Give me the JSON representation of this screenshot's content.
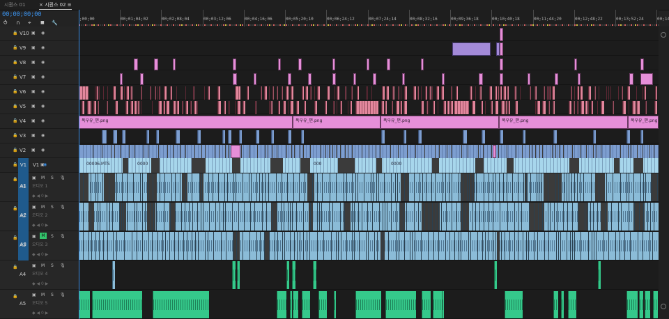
{
  "tabs": [
    {
      "label": "시퀀스 01",
      "active": false
    },
    {
      "label": "×  시퀀스 02  ≡",
      "active": true
    }
  ],
  "timecode": "00;00;00;00",
  "tools": [
    {
      "icon": "snap-icon",
      "glyph": "⥁"
    },
    {
      "icon": "linked-selection-icon",
      "glyph": "∩"
    },
    {
      "icon": "add-marker-icon",
      "glyph": "⌖"
    },
    {
      "icon": "marker-icon",
      "glyph": "■"
    },
    {
      "icon": "wrench-icon",
      "glyph": "🔧"
    }
  ],
  "ruler": [
    {
      "label": ";00;00",
      "pos": 0.0
    },
    {
      "label": "00;01;04;02",
      "pos": 0.0712
    },
    {
      "label": "00;02;08;04",
      "pos": 0.1424
    },
    {
      "label": "00;03;12;06",
      "pos": 0.2136
    },
    {
      "label": "00;04;16;06",
      "pos": 0.2848
    },
    {
      "label": "00;05;20;10",
      "pos": 0.356
    },
    {
      "label": "00;06;24;12",
      "pos": 0.4272
    },
    {
      "label": "00;07;24;14",
      "pos": 0.4984
    },
    {
      "label": "00;08;32;16",
      "pos": 0.5696
    },
    {
      "label": "00;09;36;18",
      "pos": 0.6408
    },
    {
      "label": "00;10;40;18",
      "pos": 0.712
    },
    {
      "label": "00;11;44;20",
      "pos": 0.7832
    },
    {
      "label": "00;12;48;22",
      "pos": 0.8544
    },
    {
      "label": "00;13;52;24",
      "pos": 0.9256
    },
    {
      "label": "00;14;56;26",
      "pos": 0.9968
    }
  ],
  "video_tracks": [
    "V10",
    "V9",
    "V8",
    "V7",
    "V6",
    "V5",
    "V4",
    "V3",
    "V2",
    "V1"
  ],
  "audio_tracks": [
    {
      "name": "A1",
      "label": "오디오 1"
    },
    {
      "name": "A2",
      "label": "오디오 2"
    },
    {
      "name": "A3",
      "label": "오디오 3"
    },
    {
      "name": "A4",
      "label": "오디오 4"
    },
    {
      "name": "A5",
      "label": "오디오 5"
    }
  ],
  "source_patch": {
    "video": "V1",
    "audio": [
      "A1",
      "A2",
      "A3"
    ]
  },
  "audio_buttons": {
    "mute": "M",
    "solo": "S"
  },
  "clip_labels": {
    "v4": "폭우유_편.png",
    "v1a": "00006.MTS",
    "v1b": "0000",
    "v1c": "000",
    "v1d": "0000"
  },
  "colors": {
    "timecode": "#3a8fe6",
    "video_pink": "#e68fd9",
    "video_rose": "#e3879d",
    "video_lavender": "#a38ad8",
    "video_blue": "#7d9ed0",
    "video_cyan": "#a7d6ec",
    "audio_blue": "#8bbcd8",
    "audio_green": "#35c98b"
  }
}
